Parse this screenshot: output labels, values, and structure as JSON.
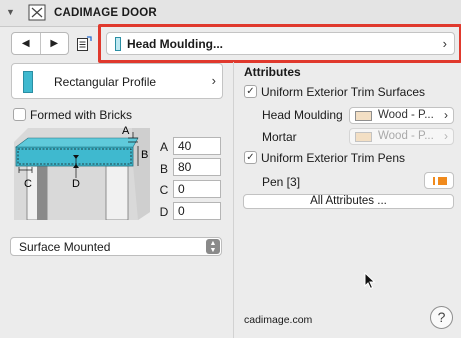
{
  "header": {
    "title": "CADIMAGE DOOR"
  },
  "toolbar": {
    "back_icon": "chevron-left-icon",
    "forward_icon": "chevron-right-icon",
    "settings_icon": "settings-list-icon"
  },
  "selector": {
    "label": "Head Moulding..."
  },
  "profile": {
    "label": "Rectangular Profile"
  },
  "formed_with_bricks": {
    "label": "Formed with Bricks",
    "checked": false
  },
  "diagram_labels": {
    "a": "A",
    "b": "B",
    "c": "C",
    "d": "D"
  },
  "fields": [
    {
      "label": "A",
      "value": "40"
    },
    {
      "label": "B",
      "value": "80"
    },
    {
      "label": "C",
      "value": "0"
    },
    {
      "label": "D",
      "value": "0"
    }
  ],
  "mount_select": {
    "value": "Surface Mounted"
  },
  "attributes": {
    "title": "Attributes",
    "uniform_surfaces": {
      "label": "Uniform Exterior Trim Surfaces",
      "checked": true
    },
    "head_moulding": {
      "label": "Head Moulding",
      "value": "Wood - P..."
    },
    "mortar": {
      "label": "Mortar",
      "value": "Wood - P..."
    },
    "uniform_pens": {
      "label": "Uniform Exterior Trim Pens",
      "checked": true
    },
    "pen": {
      "label": "Pen [3]",
      "color": "#f08a1c"
    },
    "all_attributes_label": "All Attributes ..."
  },
  "footer": {
    "site": "cadimage.com",
    "help_label": "?"
  },
  "colors": {
    "highlight": "#e0392d",
    "accent_teal": "#3fb9cf",
    "material_swatch": "#f3dfc4"
  }
}
